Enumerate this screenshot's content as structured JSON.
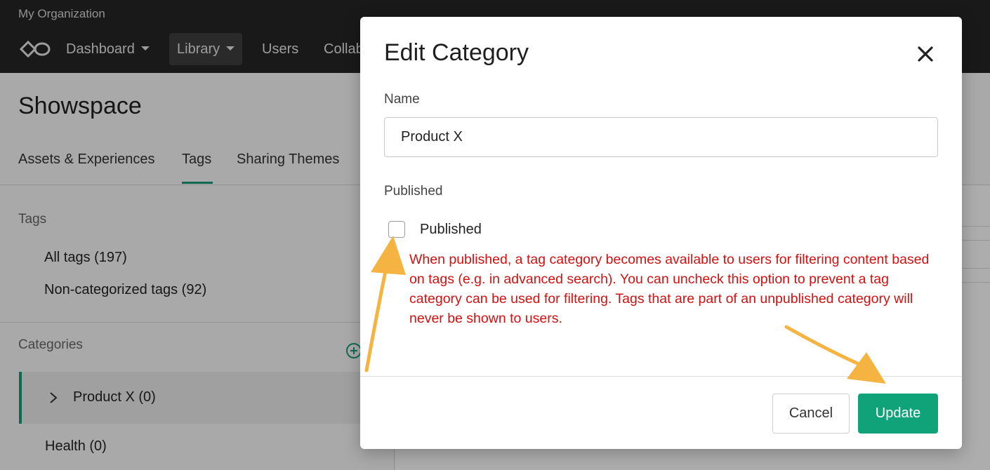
{
  "header": {
    "org_name": "My Organization",
    "nav": [
      {
        "label": "Dashboard",
        "has_caret": true
      },
      {
        "label": "Library",
        "has_caret": true,
        "active": true
      },
      {
        "label": "Users"
      },
      {
        "label": "Collab"
      }
    ]
  },
  "page": {
    "title": "Showspace",
    "tabs": [
      {
        "label": "Assets & Experiences"
      },
      {
        "label": "Tags",
        "active": true
      },
      {
        "label": "Sharing Themes"
      }
    ]
  },
  "sidebar": {
    "tags_title": "Tags",
    "tag_links": [
      "All tags (197)",
      "Non-categorized tags (92)"
    ],
    "categories_title": "Categories",
    "categories": [
      {
        "label": "Product X (0)",
        "selected": true
      },
      {
        "label": "Health (0)"
      }
    ]
  },
  "modal": {
    "title": "Edit Category",
    "name_label": "Name",
    "name_value": "Product X",
    "published_label": "Published",
    "checkbox_label": "Published",
    "checkbox_checked": false,
    "help_text": "When published, a tag category becomes available to users for filtering content based on tags (e.g. in advanced search). You can uncheck this option to prevent a tag category can be used for filtering. Tags that are part of an unpublished category will never be shown to users.",
    "cancel_label": "Cancel",
    "update_label": "Update"
  },
  "colors": {
    "accent": "#10a37a",
    "help_text": "#d41010",
    "annotation_arrow": "#f5b342",
    "topbar": "#262626"
  },
  "icons": [
    "logo-icon",
    "caret-down-icon",
    "add-category-icon",
    "chevron-right-icon",
    "close-icon"
  ]
}
